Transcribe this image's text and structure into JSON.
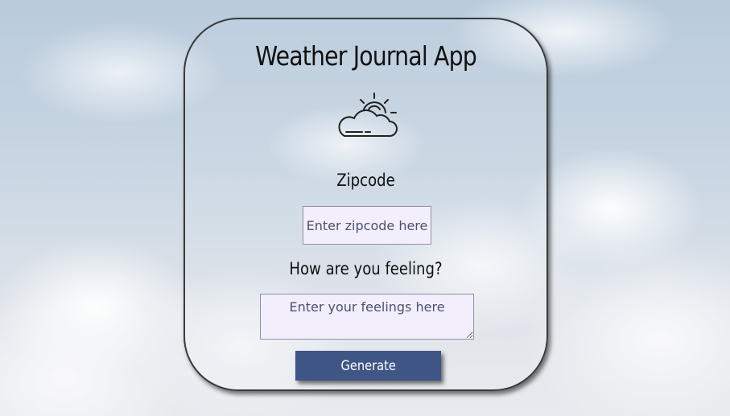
{
  "app": {
    "title": "Weather Journal App",
    "icon": "sun-behind-cloud-icon"
  },
  "form": {
    "zipcode_label": "Zipcode",
    "zipcode_placeholder": "Enter zipcode here",
    "zipcode_value": "",
    "feelings_label": "How are you feeling?",
    "feelings_placeholder": "Enter your feelings here",
    "feelings_value": "",
    "generate_label": "Generate"
  },
  "colors": {
    "button_bg": "#3f5585",
    "input_bg": "#f3eefb",
    "card_border": "#3a3a3a"
  }
}
